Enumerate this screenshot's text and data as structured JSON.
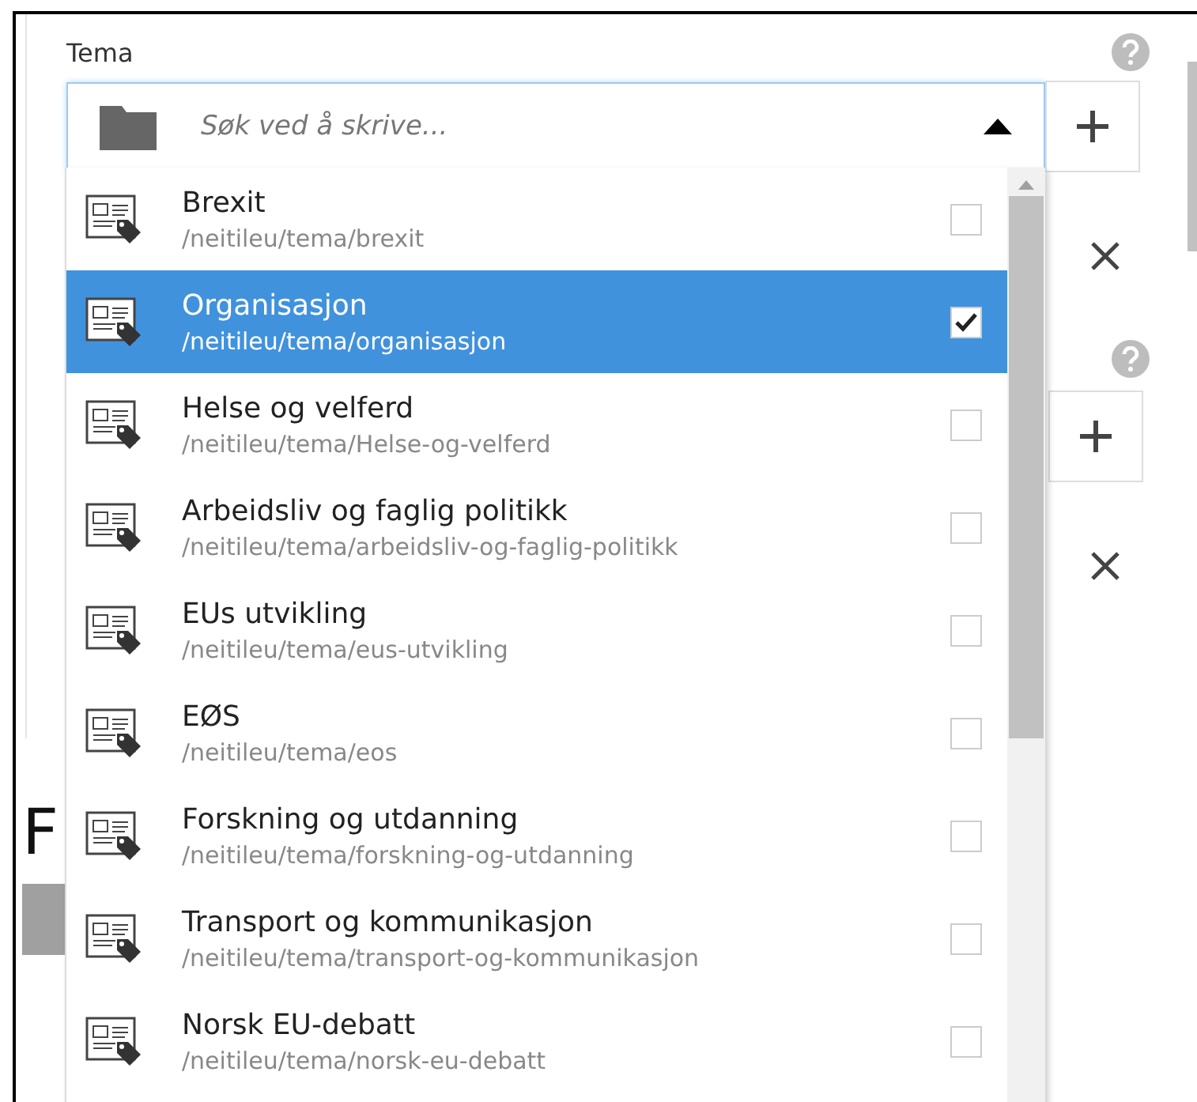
{
  "field": {
    "label": "Tema",
    "placeholder": "Søk ved å skrive...",
    "expanded": true
  },
  "options": [
    {
      "title": "Brexit",
      "path": "/neitileu/tema/brexit",
      "selected": false
    },
    {
      "title": "Organisasjon",
      "path": "/neitileu/tema/organisasjon",
      "selected": true
    },
    {
      "title": "Helse og velferd",
      "path": "/neitileu/tema/Helse-og-velferd",
      "selected": false
    },
    {
      "title": "Arbeidsliv og faglig politikk",
      "path": "/neitileu/tema/arbeidsliv-og-faglig-politikk",
      "selected": false
    },
    {
      "title": "EUs utvikling",
      "path": "/neitileu/tema/eus-utvikling",
      "selected": false
    },
    {
      "title": "EØS",
      "path": "/neitileu/tema/eos",
      "selected": false
    },
    {
      "title": "Forskning og utdanning",
      "path": "/neitileu/tema/forskning-og-utdanning",
      "selected": false
    },
    {
      "title": "Transport og kommunikasjon",
      "path": "/neitileu/tema/transport-og-kommunikasjon",
      "selected": false
    },
    {
      "title": "Norsk EU-debatt",
      "path": "/neitileu/tema/norsk-eu-debatt",
      "selected": false
    }
  ],
  "background": {
    "heading": "F"
  }
}
